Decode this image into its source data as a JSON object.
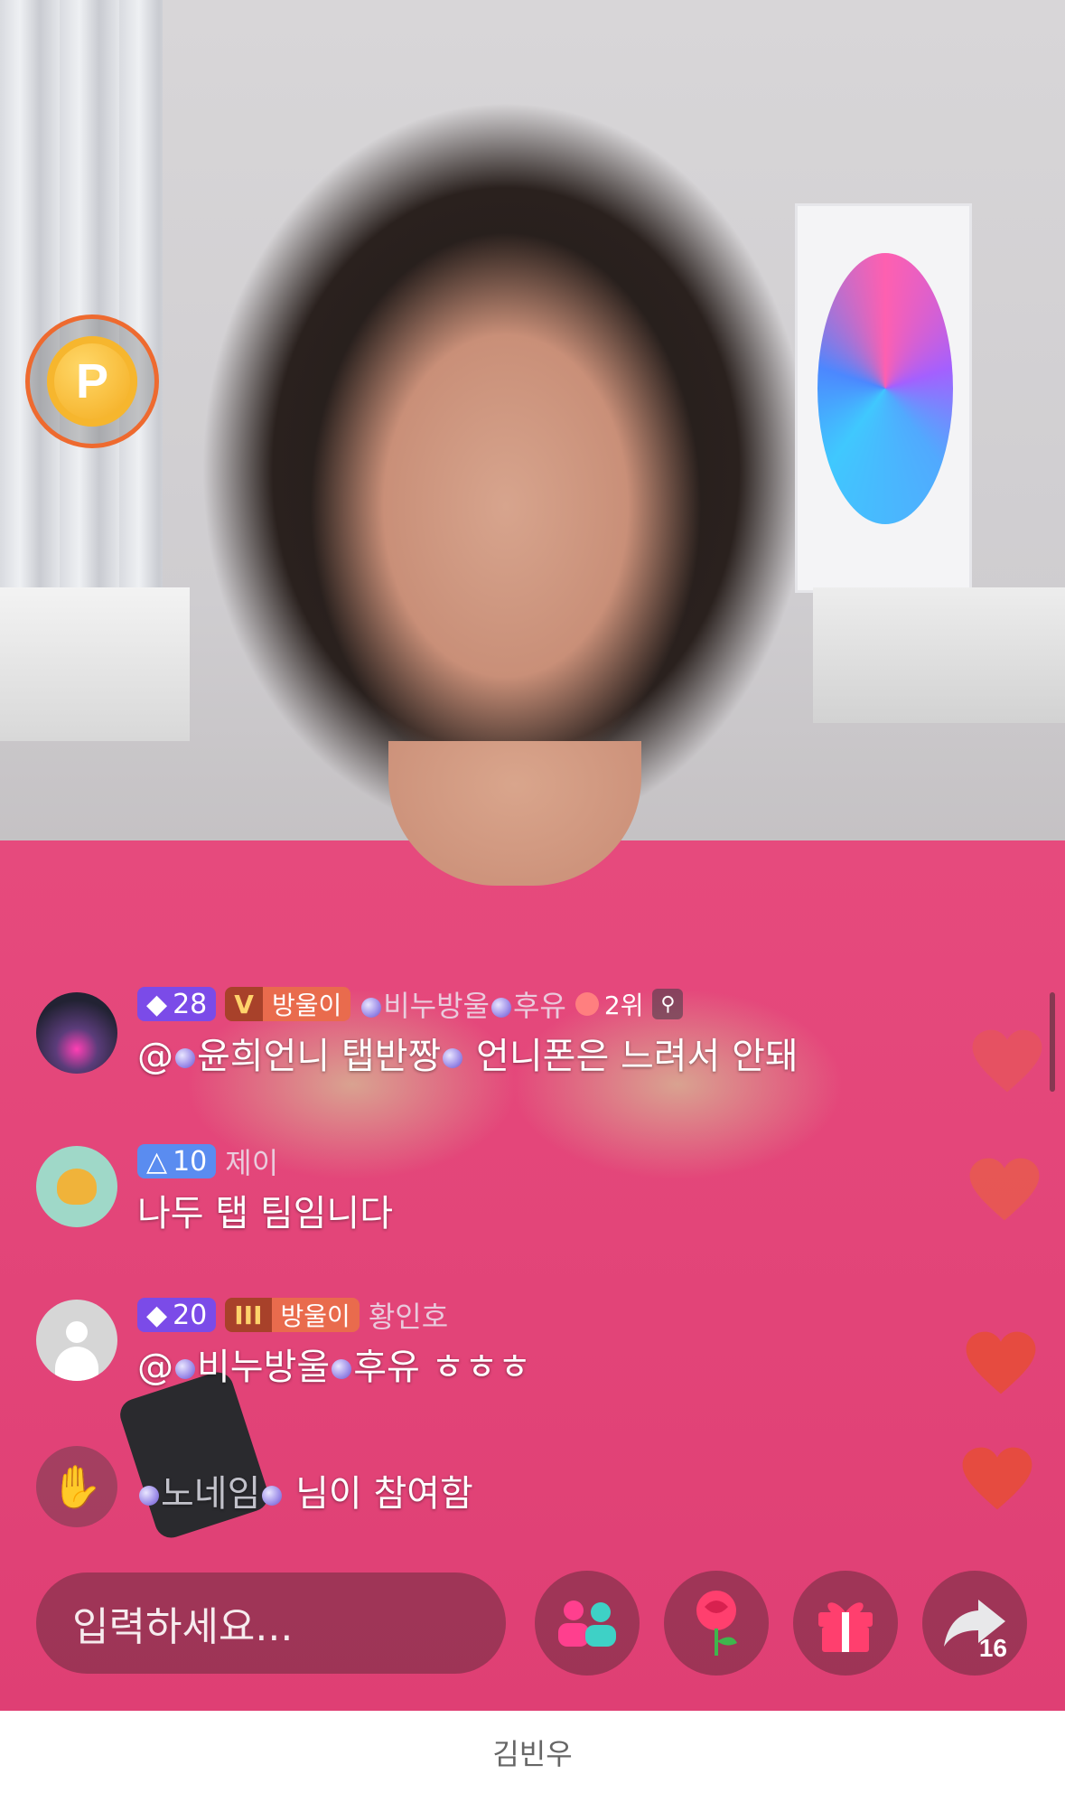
{
  "screen": {
    "type": "live-stream",
    "accent_color": "#e64a7d"
  },
  "points_button": {
    "letter": "P",
    "icon": "points-coin-icon"
  },
  "chat": [
    {
      "avatar": "avatar-photo",
      "gem_level": "28",
      "fan_badge_level": "V",
      "fan_badge_label": "방울이",
      "nickname": "비누방울",
      "nickname_suffix": "후유",
      "rank": "2위",
      "message_prefix": "@",
      "message_name": "윤희언니 탭반짱",
      "message_text": "언니폰은 느려서 안돼"
    },
    {
      "avatar": "avatar-monster",
      "gem_level": "10",
      "nickname": "제이",
      "message_text": "나두 탭 팀임니다"
    },
    {
      "avatar": "avatar-default",
      "gem_level": "20",
      "fan_badge_level": "III",
      "fan_badge_label": "방울이",
      "nickname": "황인호",
      "message_prefix": "@",
      "message_name": "비누방울",
      "message_name_suffix": "후유",
      "message_text": "ㅎㅎㅎ"
    },
    {
      "avatar": "wave-hand",
      "join_name": "노네임",
      "join_text": "님이 참여함"
    }
  ],
  "input": {
    "placeholder": "입력하세요..."
  },
  "actions": {
    "share_count": "16"
  },
  "caption": "김빈우"
}
